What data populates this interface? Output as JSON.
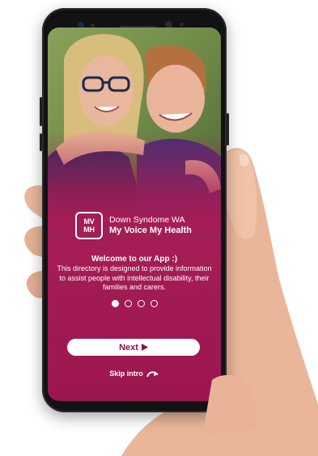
{
  "org": {
    "logo_top": "MV",
    "logo_bottom": "MH",
    "name": "Down Syndome WA",
    "tagline": "My Voice My Health"
  },
  "intro": {
    "welcome": "Welcome to our App :)",
    "description": "This directory is designed to provide information to assist people with intellectual disability, their families and carers.",
    "page_count": 4,
    "active_page": 1
  },
  "actions": {
    "next_label": "Next",
    "next_icon": "play-triangle-icon",
    "skip_label": "Skip intro",
    "skip_icon": "curved-arrow-icon"
  },
  "colors": {
    "brand": "#a51c56",
    "button_text": "#8c1148",
    "phone_body": "#121214"
  }
}
